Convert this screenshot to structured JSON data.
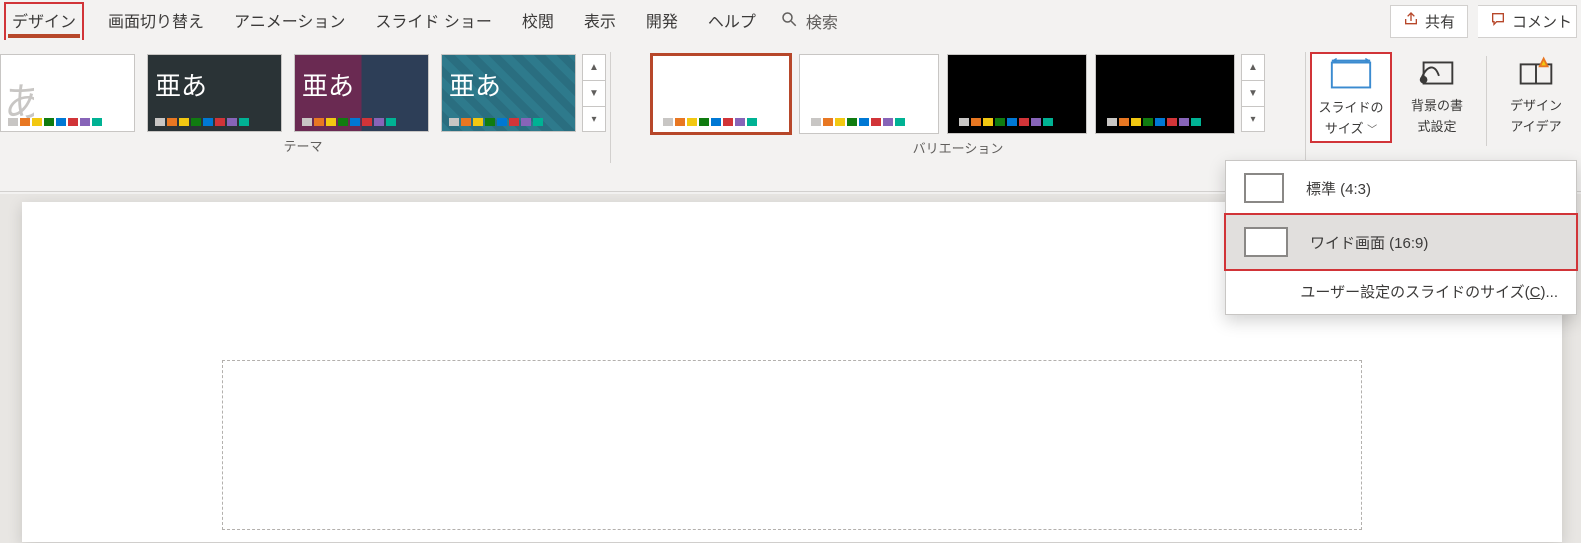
{
  "tabs": {
    "design": "デザイン",
    "transitions": "画面切り替え",
    "animations": "アニメーション",
    "slideshow": "スライド ショー",
    "review": "校閲",
    "view": "表示",
    "developer": "開発",
    "help": "ヘルプ"
  },
  "search": {
    "placeholder": "検索"
  },
  "share": {
    "label": "共有"
  },
  "comment": {
    "label": "コメント"
  },
  "themes": {
    "group_label": "テーマ",
    "items": [
      {
        "title": "あ"
      },
      {
        "title": "亜あ"
      },
      {
        "title": "亜あ"
      },
      {
        "title": "亜あ"
      }
    ]
  },
  "variations": {
    "group_label": "バリエーション"
  },
  "customize": {
    "slide_size": {
      "line1": "スライドの",
      "line2": "サイズ"
    },
    "background": {
      "line1": "背景の書",
      "line2": "式設定"
    },
    "design_ideas": {
      "line1": "デザイン",
      "line2": "アイデア"
    }
  },
  "slide_size_menu": {
    "standard": "標準 (4:3)",
    "widescreen": "ワイド画面 (16:9)",
    "custom_pre": "ユーザー設定のスライドのサイズ(",
    "custom_key": "C",
    "custom_post": ")..."
  },
  "swatch_palettes": {
    "light": [
      "#f2c811",
      "#e87722",
      "#d13438",
      "#8764b8",
      "#0078d4",
      "#00b294"
    ],
    "multi": [
      "#c8c6c4",
      "#e87722",
      "#f2c811",
      "#107c10",
      "#0078d4",
      "#d13438",
      "#8764b8",
      "#00b294"
    ]
  }
}
